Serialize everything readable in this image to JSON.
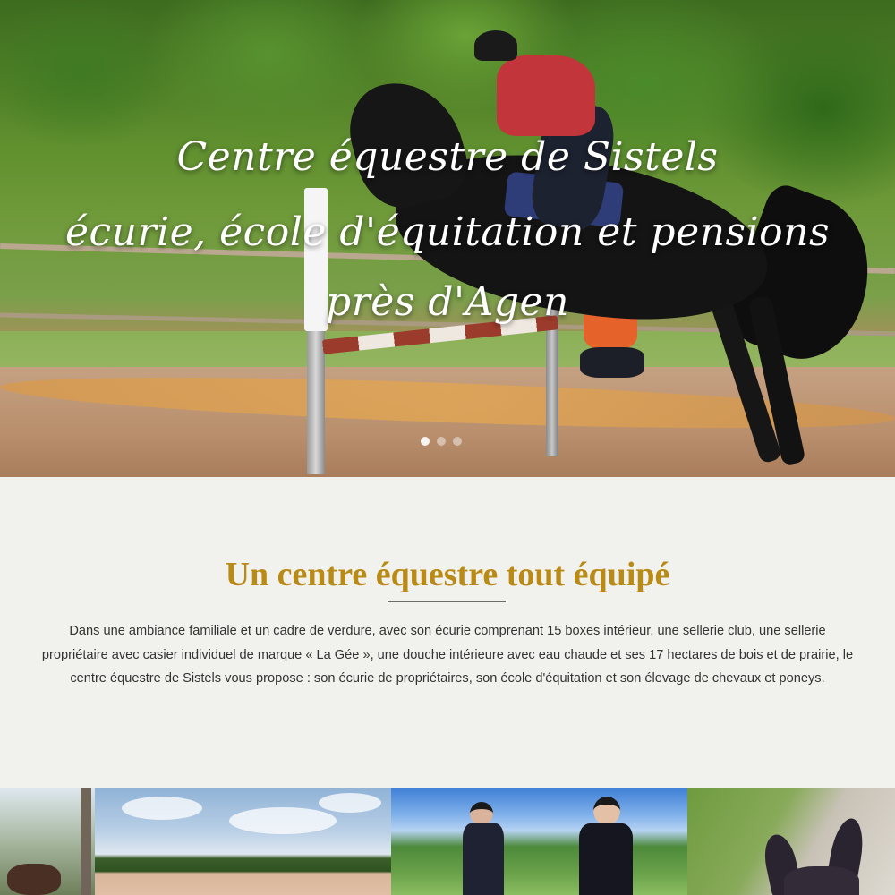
{
  "hero": {
    "title_line1": "Centre équestre de Sistels",
    "title_line2": "écurie, école d'équitation et pensions",
    "title_line3": "près d'Agen",
    "slider": {
      "total_slides": 3,
      "active_slide": 1
    }
  },
  "intro_section": {
    "title": "Un centre équestre tout équipé",
    "text": "Dans une ambiance familiale et un cadre de verdure, avec son écurie comprenant 15 boxes intérieur, une sellerie club, une sellerie propriétaire avec casier individuel de marque « La Gée », une douche intérieure avec eau chaude et ses 17 hectares de bois et de prairie, le centre équestre de Sistels vous propose : son écurie de propriétaires, son école d'équitation et son élevage de chevaux et poneys."
  },
  "colors": {
    "page_background": "#f1f2ee",
    "section_title": "#b98b16",
    "body_text": "#333333",
    "hero_text": "#ffffff"
  }
}
